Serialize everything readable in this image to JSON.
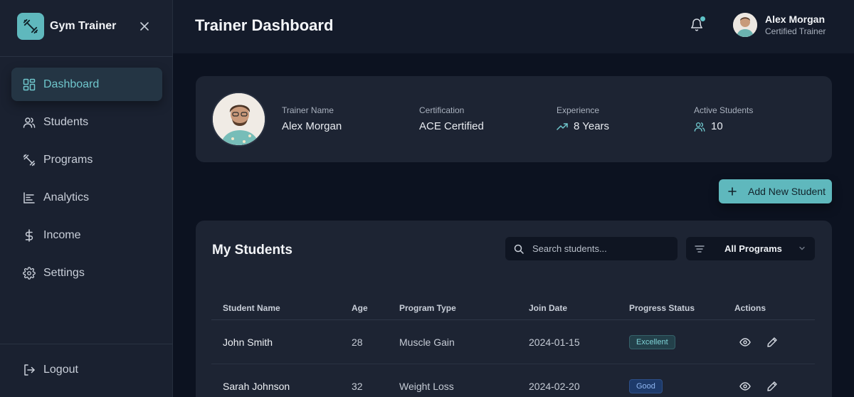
{
  "sidebar": {
    "brand": "Gym Trainer",
    "items": [
      {
        "label": "Dashboard",
        "icon": "grid-icon",
        "active": true
      },
      {
        "label": "Students",
        "icon": "users-icon",
        "active": false
      },
      {
        "label": "Programs",
        "icon": "dumbbell-icon",
        "active": false
      },
      {
        "label": "Analytics",
        "icon": "chart-icon",
        "active": false
      },
      {
        "label": "Income",
        "icon": "dollar-icon",
        "active": false
      },
      {
        "label": "Settings",
        "icon": "gear-icon",
        "active": false
      }
    ],
    "logout_label": "Logout"
  },
  "header": {
    "title": "Trainer Dashboard",
    "user_name": "Alex Morgan",
    "user_role": "Certified Trainer",
    "has_notification": true
  },
  "profile": {
    "trainer_name_label": "Trainer Name",
    "trainer_name": "Alex Morgan",
    "certification_label": "Certification",
    "certification": "ACE Certified",
    "experience_label": "Experience",
    "experience": "8 Years",
    "active_students_label": "Active Students",
    "active_students": "10"
  },
  "actions": {
    "add_student_label": "Add New Student"
  },
  "students": {
    "title": "My Students",
    "search_placeholder": "Search students...",
    "filter_value": "All Programs",
    "columns": [
      "Student Name",
      "Age",
      "Program Type",
      "Join Date",
      "Progress Status",
      "Actions"
    ],
    "rows": [
      {
        "name": "John Smith",
        "age": "28",
        "program": "Muscle Gain",
        "join_date": "2024-01-15",
        "status": "Excellent",
        "status_type": "excellent"
      },
      {
        "name": "Sarah Johnson",
        "age": "32",
        "program": "Weight Loss",
        "join_date": "2024-02-20",
        "status": "Good",
        "status_type": "good"
      }
    ]
  },
  "colors": {
    "accent": "#5fb8bd",
    "background": "#0c1220",
    "card": "#1d2433",
    "sidebar": "#1a2130"
  }
}
